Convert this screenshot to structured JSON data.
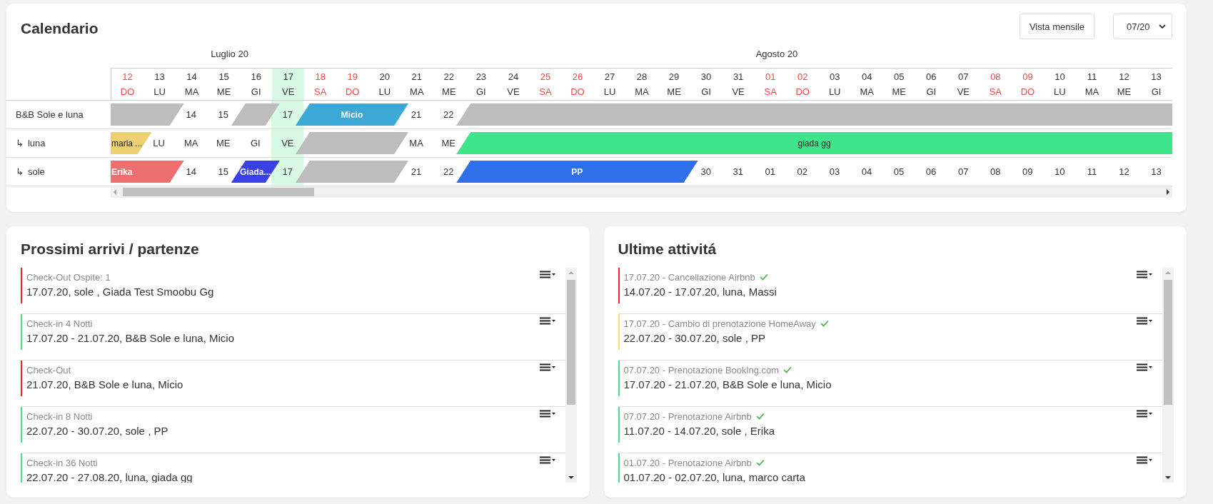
{
  "calendar": {
    "title": "Calendario",
    "view_button": "Vista mensile",
    "month_select": "07/20",
    "days": [
      {
        "day": "12",
        "weekday": "DO",
        "weekend": true,
        "today": false
      },
      {
        "day": "13",
        "weekday": "LU",
        "weekend": false,
        "today": false
      },
      {
        "day": "14",
        "weekday": "MA",
        "weekend": false,
        "today": false
      },
      {
        "day": "15",
        "weekday": "ME",
        "weekend": false,
        "today": false,
        "month": "Luglio 20"
      },
      {
        "day": "16",
        "weekday": "GI",
        "weekend": false,
        "today": false
      },
      {
        "day": "17",
        "weekday": "VE",
        "weekend": false,
        "today": true
      },
      {
        "day": "18",
        "weekday": "SA",
        "weekend": true,
        "today": false
      },
      {
        "day": "19",
        "weekday": "DO",
        "weekend": true,
        "today": false
      },
      {
        "day": "20",
        "weekday": "LU",
        "weekend": false,
        "today": false
      },
      {
        "day": "21",
        "weekday": "MA",
        "weekend": false,
        "today": false
      },
      {
        "day": "22",
        "weekday": "ME",
        "weekend": false,
        "today": false
      },
      {
        "day": "23",
        "weekday": "GI",
        "weekend": false,
        "today": false
      },
      {
        "day": "24",
        "weekday": "VE",
        "weekend": false,
        "today": false
      },
      {
        "day": "25",
        "weekday": "SA",
        "weekend": true,
        "today": false
      },
      {
        "day": "26",
        "weekday": "DO",
        "weekend": true,
        "today": false
      },
      {
        "day": "27",
        "weekday": "LU",
        "weekend": false,
        "today": false
      },
      {
        "day": "28",
        "weekday": "MA",
        "weekend": false,
        "today": false
      },
      {
        "day": "29",
        "weekday": "ME",
        "weekend": false,
        "today": false
      },
      {
        "day": "30",
        "weekday": "GI",
        "weekend": false,
        "today": false
      },
      {
        "day": "31",
        "weekday": "VE",
        "weekend": false,
        "today": false
      },
      {
        "day": "01",
        "weekday": "SA",
        "weekend": true,
        "today": false,
        "month": "Agosto 20"
      },
      {
        "day": "02",
        "weekday": "DO",
        "weekend": true,
        "today": false
      },
      {
        "day": "03",
        "weekday": "LU",
        "weekend": false,
        "today": false
      },
      {
        "day": "04",
        "weekday": "MA",
        "weekend": false,
        "today": false
      },
      {
        "day": "05",
        "weekday": "ME",
        "weekend": false,
        "today": false
      },
      {
        "day": "06",
        "weekday": "GI",
        "weekend": false,
        "today": false
      },
      {
        "day": "07",
        "weekday": "VE",
        "weekend": false,
        "today": false
      },
      {
        "day": "08",
        "weekday": "SA",
        "weekend": true,
        "today": false
      },
      {
        "day": "09",
        "weekday": "DO",
        "weekend": true,
        "today": false
      },
      {
        "day": "10",
        "weekday": "LU",
        "weekend": false,
        "today": false
      },
      {
        "day": "11",
        "weekday": "MA",
        "weekend": false,
        "today": false
      },
      {
        "day": "12",
        "weekday": "ME",
        "weekend": false,
        "today": false
      },
      {
        "day": "13",
        "weekday": "GI",
        "weekend": false,
        "today": false
      }
    ],
    "rows": [
      {
        "name": "B&B Sole e luna",
        "cells": [
          {
            "kind": "covered",
            "starts": {
              "color": "#bdbdbd"
            }
          },
          {
            "kind": "covered"
          },
          {
            "kind": "free",
            "text": "14"
          },
          {
            "kind": "free",
            "text": "15",
            "starts": {
              "color": "#bdbdbd"
            }
          },
          {
            "kind": "covered"
          },
          {
            "kind": "free",
            "text": "17",
            "starts": {
              "label": "Micio",
              "color": "#3ca8d6"
            }
          },
          {
            "kind": "covered"
          },
          {
            "kind": "covered"
          },
          {
            "kind": "covered"
          },
          {
            "kind": "free",
            "text": "21"
          },
          {
            "kind": "free",
            "text": "22",
            "starts": {
              "color": "#bdbdbd"
            }
          },
          {
            "kind": "covered"
          },
          {
            "kind": "covered"
          },
          {
            "kind": "covered"
          },
          {
            "kind": "covered"
          },
          {
            "kind": "covered"
          },
          {
            "kind": "covered"
          },
          {
            "kind": "covered"
          },
          {
            "kind": "covered"
          },
          {
            "kind": "covered"
          },
          {
            "kind": "covered"
          },
          {
            "kind": "covered"
          },
          {
            "kind": "covered"
          },
          {
            "kind": "covered"
          },
          {
            "kind": "covered"
          },
          {
            "kind": "covered"
          },
          {
            "kind": "covered"
          },
          {
            "kind": "covered"
          },
          {
            "kind": "covered"
          },
          {
            "kind": "covered"
          },
          {
            "kind": "covered"
          },
          {
            "kind": "covered"
          },
          {
            "kind": "covered"
          }
        ]
      },
      {
        "name": "luna",
        "marker": "↳",
        "cells": [
          {
            "kind": "covered",
            "starts": {
              "label": "maria ...",
              "color": "#edd072"
            }
          },
          {
            "kind": "free",
            "text": "LU"
          },
          {
            "kind": "free",
            "text": "MA"
          },
          {
            "kind": "free",
            "text": "ME"
          },
          {
            "kind": "free",
            "text": "GI"
          },
          {
            "kind": "free",
            "text": "VE",
            "starts": {
              "color": "#bdbdbd"
            }
          },
          {
            "kind": "covered"
          },
          {
            "kind": "covered"
          },
          {
            "kind": "covered"
          },
          {
            "kind": "free",
            "text": "MA"
          },
          {
            "kind": "free",
            "text": "ME",
            "starts": {
              "label": "giada gg",
              "color": "#3ee58a"
            }
          },
          {
            "kind": "covered"
          },
          {
            "kind": "covered"
          },
          {
            "kind": "covered"
          },
          {
            "kind": "covered"
          },
          {
            "kind": "covered"
          },
          {
            "kind": "covered"
          },
          {
            "kind": "covered"
          },
          {
            "kind": "covered"
          },
          {
            "kind": "covered"
          },
          {
            "kind": "covered"
          },
          {
            "kind": "covered"
          },
          {
            "kind": "covered"
          },
          {
            "kind": "covered"
          },
          {
            "kind": "covered"
          },
          {
            "kind": "covered"
          },
          {
            "kind": "covered"
          },
          {
            "kind": "covered"
          },
          {
            "kind": "covered"
          },
          {
            "kind": "covered"
          },
          {
            "kind": "covered"
          },
          {
            "kind": "covered"
          },
          {
            "kind": "covered"
          }
        ]
      },
      {
        "name": "sole",
        "marker": "↳",
        "cells": [
          {
            "kind": "covered",
            "starts": {
              "label": "Erika",
              "color": "#ee6f6f"
            }
          },
          {
            "kind": "covered"
          },
          {
            "kind": "free",
            "text": "14"
          },
          {
            "kind": "free",
            "text": "15",
            "starts": {
              "label": "Giada...",
              "color": "#3a40e8"
            }
          },
          {
            "kind": "covered"
          },
          {
            "kind": "free",
            "text": "17",
            "starts": {
              "color": "#bdbdbd"
            }
          },
          {
            "kind": "covered"
          },
          {
            "kind": "covered"
          },
          {
            "kind": "covered"
          },
          {
            "kind": "free",
            "text": "21"
          },
          {
            "kind": "free",
            "text": "22",
            "starts": {
              "label": "PP",
              "color": "#2f6fea"
            }
          },
          {
            "kind": "covered"
          },
          {
            "kind": "covered"
          },
          {
            "kind": "covered"
          },
          {
            "kind": "covered"
          },
          {
            "kind": "covered"
          },
          {
            "kind": "covered"
          },
          {
            "kind": "covered"
          },
          {
            "kind": "free",
            "text": "30"
          },
          {
            "kind": "free",
            "text": "31"
          },
          {
            "kind": "free",
            "text": "01"
          },
          {
            "kind": "free",
            "text": "02"
          },
          {
            "kind": "free",
            "text": "03"
          },
          {
            "kind": "free",
            "text": "04"
          },
          {
            "kind": "free",
            "text": "05"
          },
          {
            "kind": "free",
            "text": "06"
          },
          {
            "kind": "free",
            "text": "07"
          },
          {
            "kind": "free",
            "text": "08"
          },
          {
            "kind": "free",
            "text": "09"
          },
          {
            "kind": "free",
            "text": "10"
          },
          {
            "kind": "free",
            "text": "11"
          },
          {
            "kind": "free",
            "text": "12"
          },
          {
            "kind": "free",
            "text": "13"
          }
        ]
      }
    ]
  },
  "arrivals": {
    "title": "Prossimi arrivi / partenze",
    "items": [
      {
        "title": "Check-Out Ospite: 1",
        "text": "17.07.20, sole , Giada Test Smoobu Gg",
        "color": "#e8262a"
      },
      {
        "title": "Check-in 4 Notti",
        "text": "17.07.20 - 21.07.20, B&B Sole e luna, Micio",
        "color": "#4cdb8c"
      },
      {
        "title": "Check-Out",
        "text": "21.07.20, B&B Sole e luna, Micio",
        "color": "#e8262a"
      },
      {
        "title": "Check-in 8 Notti",
        "text": "22.07.20 - 30.07.20, sole , PP",
        "color": "#4cdb8c"
      },
      {
        "title": "Check-in 36 Notti",
        "text": "22.07.20 - 27.08.20, luna, giada gg",
        "color": "#4cdb8c"
      }
    ]
  },
  "activities": {
    "title": "Ultime attivitá",
    "items": [
      {
        "title": "17.07.20 - Cancellazione Airbnb",
        "text": "14.07.20 - 17.07.20, luna, Massi",
        "color": "#e8262a",
        "confirmed": true
      },
      {
        "title": "17.07.20 - Cambio di prenotazione HomeAway",
        "text": "22.07.20 - 30.07.20, sole , PP",
        "color": "#f5df78",
        "confirmed": true
      },
      {
        "title": "07.07.20 - Prenotazione Booking.com",
        "text": "17.07.20 - 21.07.20, B&B Sole e luna, Micio",
        "color": "#4cdb8c",
        "confirmed": true
      },
      {
        "title": "07.07.20 - Prenotazione Airbnb",
        "text": "11.07.20 - 14.07.20, sole , Erika",
        "color": "#4cdb8c",
        "confirmed": true
      },
      {
        "title": "01.07.20 - Prenotazione Airbnb",
        "text": "01.07.20 - 02.07.20, luna, marco carta",
        "color": "#4cdb8c",
        "confirmed": true
      }
    ]
  }
}
